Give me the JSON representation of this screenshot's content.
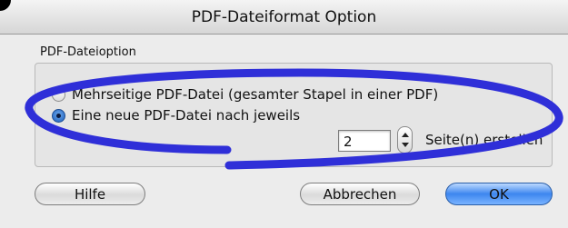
{
  "window": {
    "title": "PDF-Dateiformat Option"
  },
  "group": {
    "label": "PDF-Dateioption"
  },
  "options": [
    {
      "label": "Mehrseitige PDF-Datei (gesamter Stapel in einer PDF)",
      "selected": false
    },
    {
      "label": "Eine neue PDF-Datei nach jeweils",
      "selected": true
    }
  ],
  "pages": {
    "value": "2",
    "suffix": "Seite(n) erstellen"
  },
  "buttons": {
    "help": "Hilfe",
    "cancel": "Abbrechen",
    "ok": "OK"
  },
  "colors": {
    "annotation": "#2f2fd8",
    "ok_button": "#3d86ef"
  }
}
